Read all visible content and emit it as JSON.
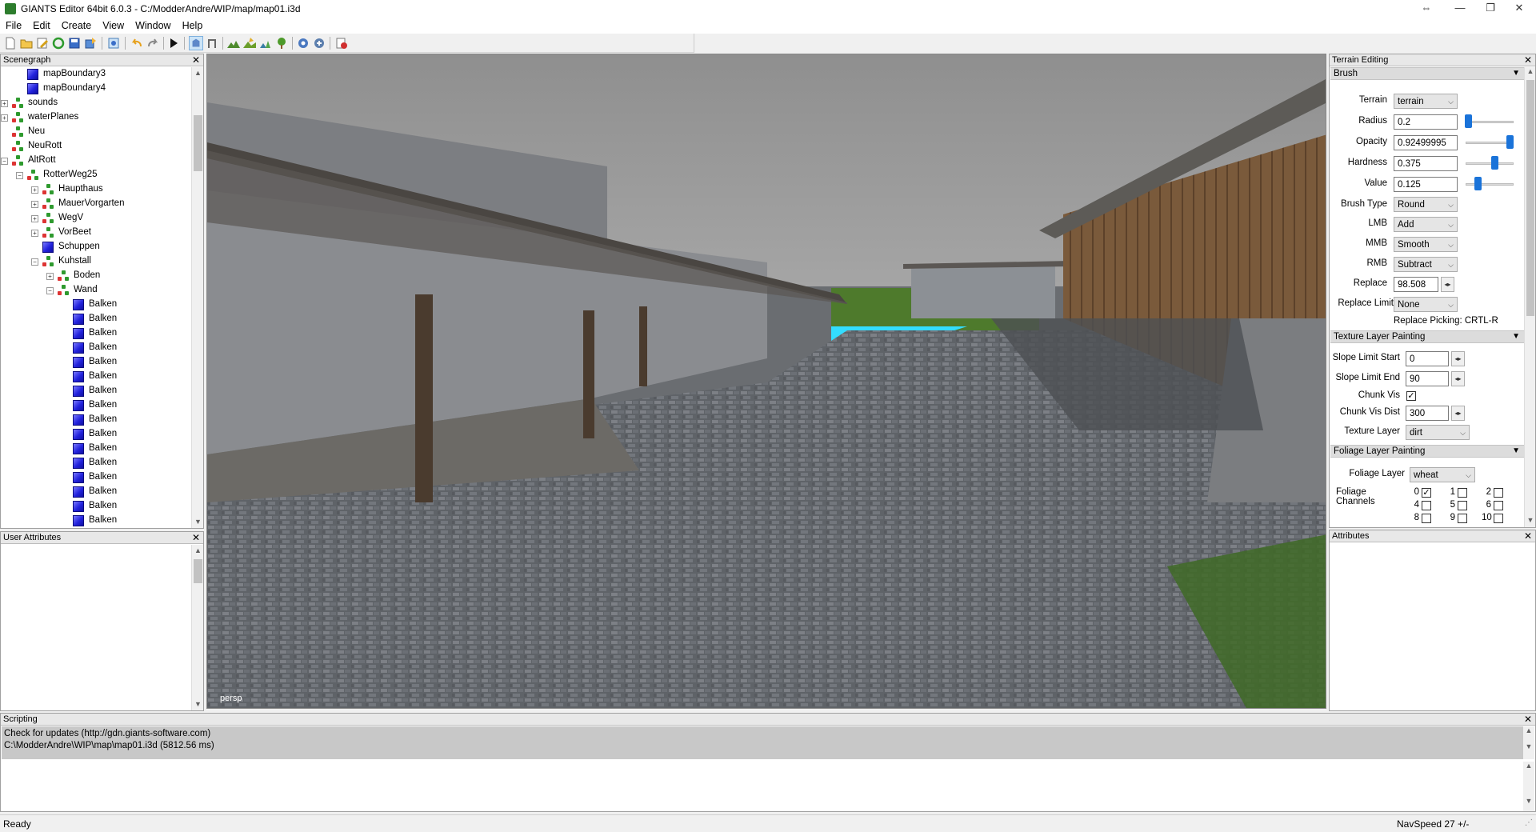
{
  "window": {
    "title": "GIANTS Editor 64bit 6.0.3 - C:/ModderAndre/WIP/map/map01.i3d",
    "btn_restore": "⇔",
    "btn_min": "—",
    "btn_max": "❐",
    "btn_close": "✕"
  },
  "menu": [
    "File",
    "Edit",
    "Create",
    "View",
    "Window",
    "Help"
  ],
  "scenegraph": {
    "title": "Scenegraph",
    "items": [
      {
        "label": "mapBoundary3",
        "depth": 1,
        "icon": "cube",
        "expander": ""
      },
      {
        "label": "mapBoundary4",
        "depth": 1,
        "icon": "cube",
        "expander": ""
      },
      {
        "label": "sounds",
        "depth": 0,
        "icon": "group",
        "expander": "+"
      },
      {
        "label": "waterPlanes",
        "depth": 0,
        "icon": "group",
        "expander": "+"
      },
      {
        "label": "Neu",
        "depth": 0,
        "icon": "group",
        "expander": ""
      },
      {
        "label": "NeuRott",
        "depth": 0,
        "icon": "group",
        "expander": ""
      },
      {
        "label": "AltRott",
        "depth": 0,
        "icon": "group",
        "expander": "−"
      },
      {
        "label": "RotterWeg25",
        "depth": 1,
        "icon": "group",
        "expander": "−"
      },
      {
        "label": "Haupthaus",
        "depth": 2,
        "icon": "group",
        "expander": "+"
      },
      {
        "label": "MauerVorgarten",
        "depth": 2,
        "icon": "group",
        "expander": "+"
      },
      {
        "label": "WegV",
        "depth": 2,
        "icon": "group",
        "expander": "+"
      },
      {
        "label": "VorBeet",
        "depth": 2,
        "icon": "group",
        "expander": "+"
      },
      {
        "label": "Schuppen",
        "depth": 2,
        "icon": "cube",
        "expander": ""
      },
      {
        "label": "Kuhstall",
        "depth": 2,
        "icon": "group",
        "expander": "−"
      },
      {
        "label": "Boden",
        "depth": 3,
        "icon": "group",
        "expander": "+"
      },
      {
        "label": "Wand",
        "depth": 3,
        "icon": "group",
        "expander": "−"
      },
      {
        "label": "Balken",
        "depth": 4,
        "icon": "cube",
        "expander": ""
      },
      {
        "label": "Balken",
        "depth": 4,
        "icon": "cube",
        "expander": ""
      },
      {
        "label": "Balken",
        "depth": 4,
        "icon": "cube",
        "expander": ""
      },
      {
        "label": "Balken",
        "depth": 4,
        "icon": "cube",
        "expander": ""
      },
      {
        "label": "Balken",
        "depth": 4,
        "icon": "cube",
        "expander": ""
      },
      {
        "label": "Balken",
        "depth": 4,
        "icon": "cube",
        "expander": ""
      },
      {
        "label": "Balken",
        "depth": 4,
        "icon": "cube",
        "expander": ""
      },
      {
        "label": "Balken",
        "depth": 4,
        "icon": "cube",
        "expander": ""
      },
      {
        "label": "Balken",
        "depth": 4,
        "icon": "cube",
        "expander": ""
      },
      {
        "label": "Balken",
        "depth": 4,
        "icon": "cube",
        "expander": ""
      },
      {
        "label": "Balken",
        "depth": 4,
        "icon": "cube",
        "expander": ""
      },
      {
        "label": "Balken",
        "depth": 4,
        "icon": "cube",
        "expander": ""
      },
      {
        "label": "Balken",
        "depth": 4,
        "icon": "cube",
        "expander": ""
      },
      {
        "label": "Balken",
        "depth": 4,
        "icon": "cube",
        "expander": ""
      },
      {
        "label": "Balken",
        "depth": 4,
        "icon": "cube",
        "expander": ""
      },
      {
        "label": "Balken",
        "depth": 4,
        "icon": "cube",
        "expander": ""
      }
    ]
  },
  "user_attributes": {
    "title": "User Attributes"
  },
  "viewport": {
    "camera_label": "persp"
  },
  "terrain_editing": {
    "title": "Terrain Editing",
    "brush": {
      "header": "Brush",
      "terrain_label": "Terrain",
      "terrain_value": "terrain",
      "radius_label": "Radius",
      "radius_value": "0.2",
      "radius_slider": 0.05,
      "opacity_label": "Opacity",
      "opacity_value": "0.92499995",
      "opacity_slider": 0.92,
      "hardness_label": "Hardness",
      "hardness_value": "0.375",
      "hardness_slider": 0.6,
      "value_label": "Value",
      "value_value": "0.125",
      "value_slider": 0.25,
      "brush_type_label": "Brush Type",
      "brush_type_value": "Round",
      "lmb_label": "LMB",
      "lmb_value": "Add",
      "mmb_label": "MMB",
      "mmb_value": "Smooth",
      "rmb_label": "RMB",
      "rmb_value": "Subtract",
      "replace_label": "Replace",
      "replace_value": "98.508",
      "replace_limit_label": "Replace Limit",
      "replace_limit_value": "None",
      "replace_picking": "Replace Picking: CRTL-R"
    },
    "texture": {
      "header": "Texture Layer Painting",
      "slope_start_label": "Slope Limit Start",
      "slope_start_value": "0",
      "slope_end_label": "Slope Limit End",
      "slope_end_value": "90",
      "chunk_vis_label": "Chunk Vis",
      "chunk_vis_checked": true,
      "chunk_vis_dist_label": "Chunk Vis Dist",
      "chunk_vis_dist_value": "300",
      "texture_layer_label": "Texture Layer",
      "texture_layer_value": "dirt"
    },
    "foliage": {
      "header": "Foliage Layer Painting",
      "foliage_layer_label": "Foliage Layer",
      "foliage_layer_value": "wheat",
      "channels_label": "Foliage Channels",
      "channels": [
        {
          "n": "0",
          "checked": true
        },
        {
          "n": "1",
          "checked": false
        },
        {
          "n": "2",
          "checked": false
        },
        {
          "n": "4",
          "checked": false
        },
        {
          "n": "5",
          "checked": false
        },
        {
          "n": "6",
          "checked": false
        },
        {
          "n": "8",
          "checked": false
        },
        {
          "n": "9",
          "checked": false
        },
        {
          "n": "10",
          "checked": false
        }
      ]
    }
  },
  "attributes": {
    "title": "Attributes"
  },
  "scripting": {
    "title": "Scripting",
    "log": [
      "Check for updates (http://gdn.giants-software.com)",
      "C:\\ModderAndre\\WIP\\map\\map01.i3d (5812.56 ms)"
    ]
  },
  "status": {
    "left": "Ready",
    "navspeed": "NavSpeed 27 +/-"
  },
  "colors": {
    "accent": "#1a73d9",
    "water": "#33ddff",
    "grass": "#4e7a2c"
  },
  "icons": [
    "new-file-icon",
    "open-folder-icon",
    "edit-icon",
    "refresh-icon",
    "save-icon",
    "export-icon",
    "properties-icon",
    "undo-icon",
    "redo-icon",
    "play-icon",
    "select-icon",
    "move-icon",
    "terrain-raise-icon",
    "terrain-paint-icon",
    "foliage-paint-icon",
    "tree-icon",
    "settings-gear-icon",
    "snap-icon",
    "record-icon"
  ]
}
